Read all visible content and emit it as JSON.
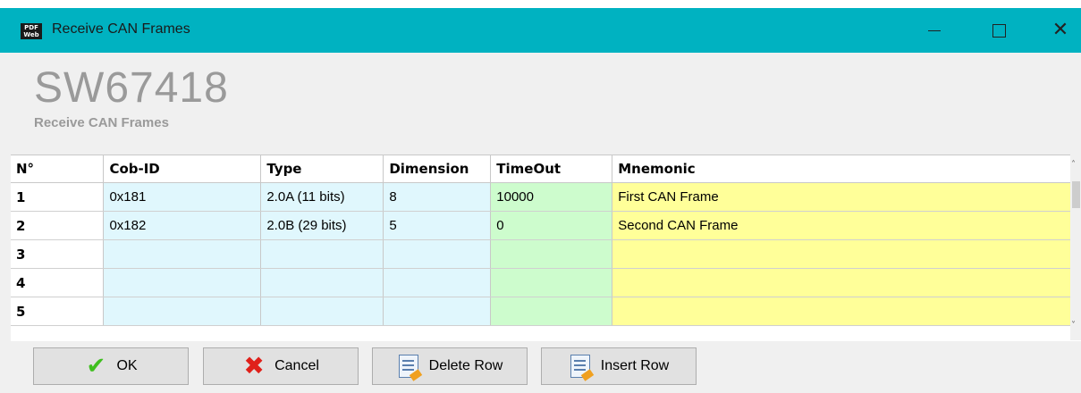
{
  "window": {
    "title": "Receive CAN Frames",
    "icon_top": "PDF",
    "icon_bottom": "Web"
  },
  "header": {
    "product": "SW67418",
    "subtitle": "Receive CAN Frames"
  },
  "grid": {
    "columns": [
      "N°",
      "Cob-ID",
      "Type",
      "Dimension",
      "TimeOut",
      "Mnemonic"
    ],
    "rows": [
      {
        "n": "1",
        "cob": "0x181",
        "type": "2.0A (11 bits)",
        "dim": "8",
        "timeout": "10000",
        "mnemonic": "First CAN Frame"
      },
      {
        "n": "2",
        "cob": "0x182",
        "type": "2.0B (29 bits)",
        "dim": "5",
        "timeout": "0",
        "mnemonic": "Second CAN Frame"
      },
      {
        "n": "3",
        "cob": "",
        "type": "",
        "dim": "",
        "timeout": "",
        "mnemonic": ""
      },
      {
        "n": "4",
        "cob": "",
        "type": "",
        "dim": "",
        "timeout": "",
        "mnemonic": ""
      },
      {
        "n": "5",
        "cob": "",
        "type": "",
        "dim": "",
        "timeout": "",
        "mnemonic": ""
      }
    ]
  },
  "buttons": {
    "ok": "OK",
    "cancel": "Cancel",
    "delete_row": "Delete Row",
    "insert_row": "Insert Row"
  },
  "colors": {
    "titlebar": "#00b2c1",
    "blue_cells": "#e0f7fd",
    "green_cells": "#cdfccd",
    "yellow_cells": "#ffff99"
  }
}
